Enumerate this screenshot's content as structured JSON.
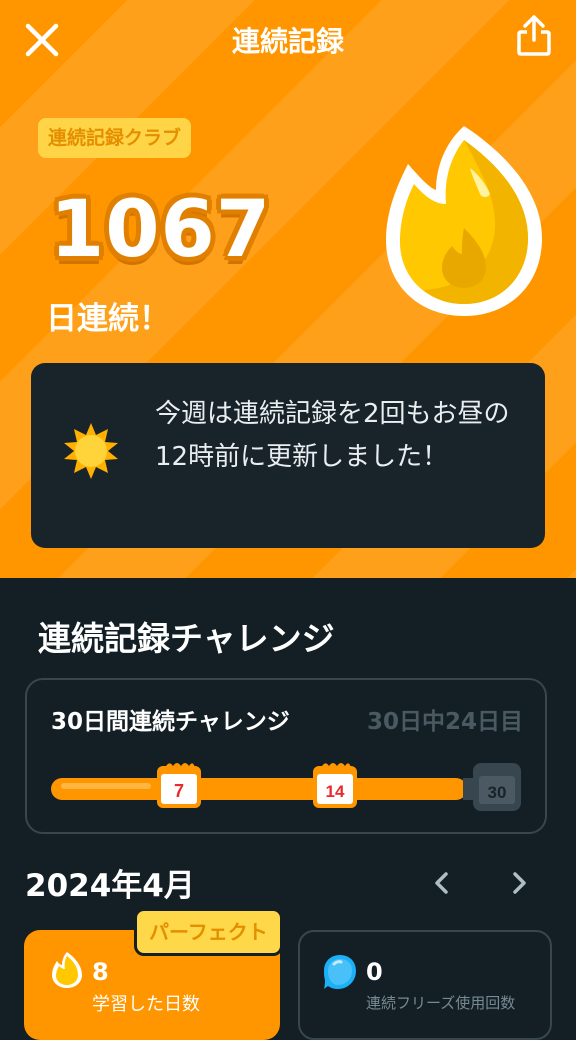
{
  "header": {
    "title": "連続記録"
  },
  "streak": {
    "club_label": "連続記録クラブ",
    "count": "1067",
    "unit_label": "日連続！"
  },
  "info": {
    "message": "今週は連続記録を2回もお昼の12時前に更新しました！"
  },
  "challenge_section": {
    "title": "連続記録チャレンジ",
    "card": {
      "title": "30日間連続チャレンジ",
      "progress_text": "30日中24日目",
      "progress_value": 24,
      "total": 30,
      "milestones": [
        "7",
        "14",
        "30"
      ]
    }
  },
  "calendar": {
    "month": "2024年4月"
  },
  "stats": {
    "perfect_badge": "パーフェクト",
    "study_days": {
      "value": "8",
      "label": "学習した日数"
    },
    "freeze_used": {
      "value": "0",
      "label": "連続フリーズ使用回数"
    }
  },
  "colors": {
    "orange": "#ff9600",
    "dark_bg": "#131f24",
    "card_bg": "#18232a",
    "badge_yellow": "#ffd84a"
  }
}
